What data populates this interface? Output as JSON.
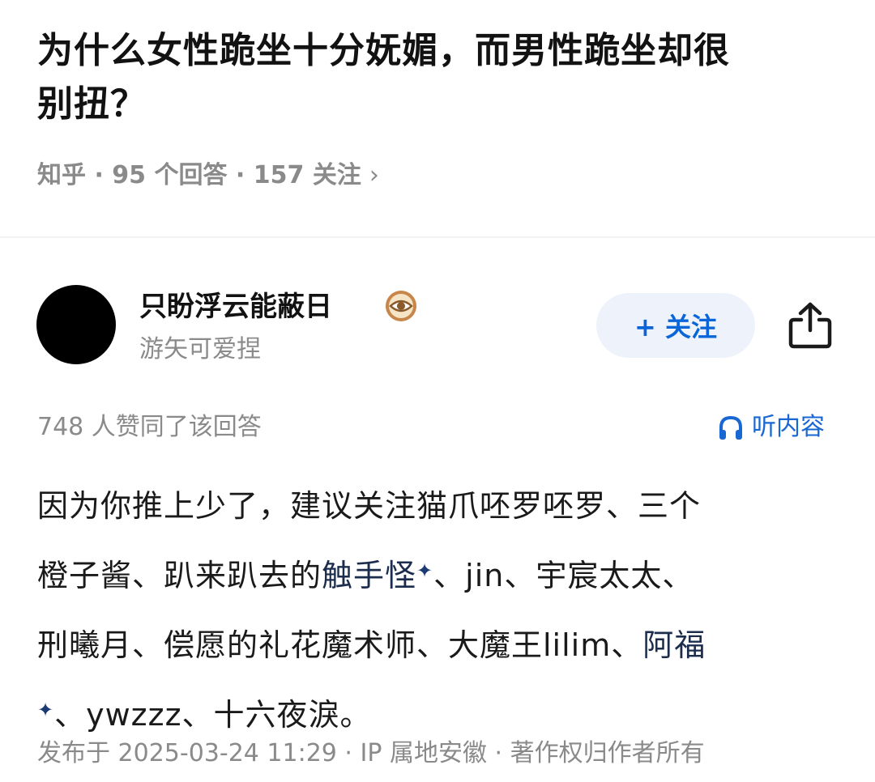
{
  "question": {
    "title_line1": "为什么女性跪坐十分妩媚，而男性跪坐却很",
    "title_line2": "别扭？",
    "meta": "知乎 · 95 个回答 · 157 关注",
    "meta_chevron": "›"
  },
  "author": {
    "name": "只盼浮云能蔽日",
    "bio": "游矢可爱捏",
    "badge_icon": "eye-badge-icon",
    "follow_label": "+ 关注"
  },
  "answer": {
    "vote_text": "748 人赞同了该回答",
    "listen_label": "听内容",
    "line1": "因为你推上少了，建议关注猫爪呸罗呸罗、三个",
    "line2_a": "橙子酱、趴来趴去的",
    "line2_kw": "触手怪",
    "line2_b": "、jin、宇宸太太、",
    "line3_a": "刑曦月、偿愿的礼花魔术师、大魔王lilim、",
    "line3_kw": "阿福",
    "line4": "、ywzzz、十六夜淚。",
    "spark": "✦",
    "footer": "发布于 2025-03-24 11:29 · IP 属地安徽 · 著作权归作者所有"
  },
  "colors": {
    "accent": "#0a66d8",
    "muted": "#8a8a8a",
    "follow_bg": "#eef3fb"
  }
}
